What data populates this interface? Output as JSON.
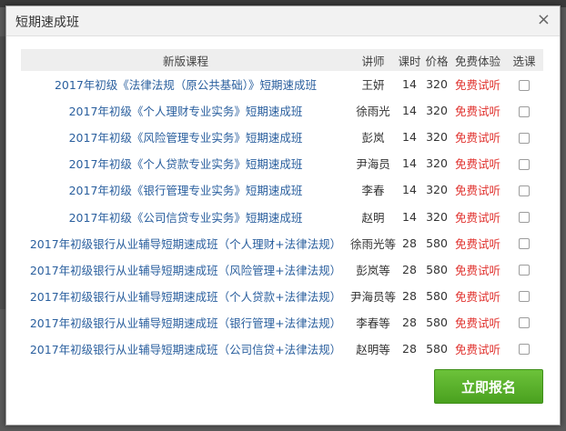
{
  "dialog": {
    "title": "短期速成班",
    "close_glyph": "×"
  },
  "table": {
    "headers": [
      "新版课程",
      "讲师",
      "课时",
      "价格",
      "免费体验",
      "选课"
    ],
    "rows": [
      {
        "course": "2017年初级《法律法规（原公共基础）》短期速成班",
        "teacher": "王妍",
        "hours": "14",
        "price": "320",
        "trial": "免费试听"
      },
      {
        "course": "2017年初级《个人理财专业实务》短期速成班",
        "teacher": "徐雨光",
        "hours": "14",
        "price": "320",
        "trial": "免费试听"
      },
      {
        "course": "2017年初级《风险管理专业实务》短期速成班",
        "teacher": "彭岚",
        "hours": "14",
        "price": "320",
        "trial": "免费试听"
      },
      {
        "course": "2017年初级《个人贷款专业实务》短期速成班",
        "teacher": "尹海员",
        "hours": "14",
        "price": "320",
        "trial": "免费试听"
      },
      {
        "course": "2017年初级《银行管理专业实务》短期速成班",
        "teacher": "李春",
        "hours": "14",
        "price": "320",
        "trial": "免费试听"
      },
      {
        "course": "2017年初级《公司信贷专业实务》短期速成班",
        "teacher": "赵明",
        "hours": "14",
        "price": "320",
        "trial": "免费试听"
      },
      {
        "course": "2017年初级银行从业辅导短期速成班（个人理财+法律法规）",
        "teacher": "徐雨光等",
        "hours": "28",
        "price": "580",
        "trial": "免费试听"
      },
      {
        "course": "2017年初级银行从业辅导短期速成班（风险管理+法律法规）",
        "teacher": "彭岚等",
        "hours": "28",
        "price": "580",
        "trial": "免费试听"
      },
      {
        "course": "2017年初级银行从业辅导短期速成班（个人贷款+法律法规）",
        "teacher": "尹海员等",
        "hours": "28",
        "price": "580",
        "trial": "免费试听"
      },
      {
        "course": "2017年初级银行从业辅导短期速成班（银行管理+法律法规）",
        "teacher": "李春等",
        "hours": "28",
        "price": "580",
        "trial": "免费试听"
      },
      {
        "course": "2017年初级银行从业辅导短期速成班（公司信贷+法律法规）",
        "teacher": "赵明等",
        "hours": "28",
        "price": "580",
        "trial": "免费试听"
      }
    ]
  },
  "signup_button": {
    "label": "立即报名"
  },
  "colors": {
    "course_link": "#2a5f9e",
    "free_trial": "#e0322e",
    "signup_green": "#5bb22c"
  }
}
